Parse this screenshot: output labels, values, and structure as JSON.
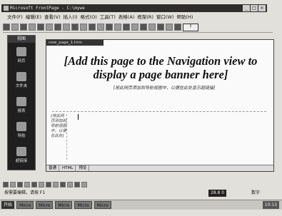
{
  "window": {
    "title": "Microsoft FrontPage - C:\\mywe"
  },
  "menu": {
    "items": [
      "文件(F)",
      "编辑(E)",
      "查看(V)",
      "插入(I)",
      "格式(O)",
      "工具(T)",
      "表格(A)",
      "框架(R)",
      "窗口(W)",
      "帮助(H)"
    ]
  },
  "toolbar": {
    "zoom": "?"
  },
  "views": {
    "header": "视图",
    "items": [
      {
        "label": "网页",
        "icon": "page-view-icon"
      },
      {
        "label": "文件夹",
        "icon": "folders-view-icon"
      },
      {
        "label": "报表",
        "icon": "reports-view-icon"
      },
      {
        "label": "导航",
        "icon": "navigation-view-icon"
      },
      {
        "label": "超链接",
        "icon": "hyperlinks-view-icon"
      }
    ]
  },
  "editor": {
    "tab_label": "new_page_1.htm",
    "banner": "[Add this page to the Navigation view to display a page banner here]",
    "banner_hint": "[将此网页添加到导航视图中，以便在此处显示超链接]",
    "left_cell": "[将此网页添加到导航视图中，以便在此处]",
    "page_tabs": [
      "普通",
      "HTML",
      "预览"
    ]
  },
  "statusbar": {
    "text": "按需要编辑，请按 F1",
    "time": "28.8 0",
    "mode": "数字"
  },
  "taskbar": {
    "start": "开始",
    "tasks": [
      "Micro",
      "Micro",
      "Micro",
      "Micro",
      "Micro"
    ],
    "tray": "10:13"
  }
}
